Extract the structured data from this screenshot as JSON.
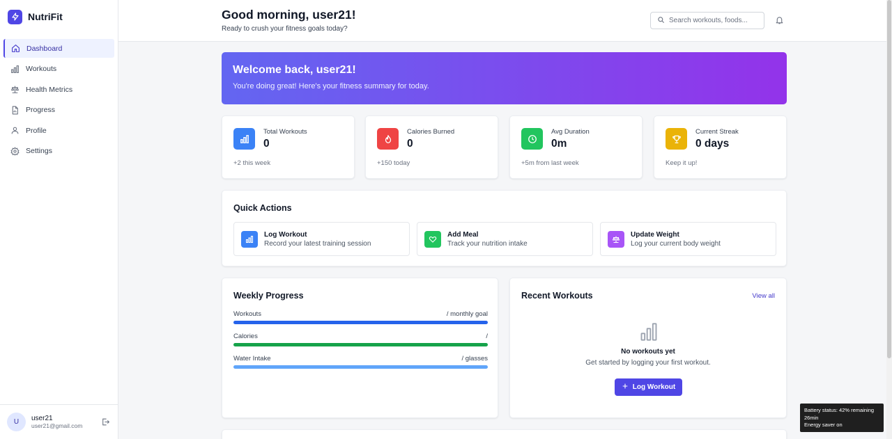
{
  "app": {
    "name": "NutriFit",
    "brand_color": "#4f46e5"
  },
  "sidebar": {
    "items": [
      {
        "label": "Dashboard",
        "icon": "home-icon",
        "active": true
      },
      {
        "label": "Workouts",
        "icon": "bar-chart-icon"
      },
      {
        "label": "Health Metrics",
        "icon": "scale-icon"
      },
      {
        "label": "Progress",
        "icon": "document-icon"
      },
      {
        "label": "Profile",
        "icon": "user-icon"
      },
      {
        "label": "Settings",
        "icon": "gear-icon"
      }
    ],
    "user": {
      "initial": "U",
      "name": "user21",
      "email": "user21@gmail.com"
    }
  },
  "header": {
    "greeting": "Good morning, user21!",
    "subtitle": "Ready to crush your fitness goals today?",
    "search_placeholder": "Search workouts, foods..."
  },
  "banner": {
    "title": "Welcome back, user21!",
    "subtitle": "You're doing great! Here's your fitness summary for today."
  },
  "stats": [
    {
      "label": "Total Workouts",
      "value": "0",
      "foot": "+2 this week",
      "color": "#3b82f6",
      "icon": "bar-chart-icon"
    },
    {
      "label": "Calories Burned",
      "value": "0",
      "foot": "+150 today",
      "color": "#ef4444",
      "icon": "flame-icon"
    },
    {
      "label": "Avg Duration",
      "value": "0m",
      "foot": "+5m from last week",
      "color": "#22c55e",
      "icon": "clock-icon"
    },
    {
      "label": "Current Streak",
      "value": "0 days",
      "foot": "Keep it up!",
      "color": "#eab308",
      "icon": "trophy-icon"
    }
  ],
  "quick_actions": {
    "title": "Quick Actions",
    "items": [
      {
        "title": "Log Workout",
        "subtitle": "Record your latest training session",
        "color": "#3b82f6",
        "icon": "bar-chart-icon"
      },
      {
        "title": "Add Meal",
        "subtitle": "Track your nutrition intake",
        "color": "#22c55e",
        "icon": "heart-icon"
      },
      {
        "title": "Update Weight",
        "subtitle": "Log your current body weight",
        "color": "#a855f7",
        "icon": "scale-icon"
      }
    ]
  },
  "weekly_progress": {
    "title": "Weekly Progress",
    "rows": [
      {
        "label": "Workouts",
        "value": "/ monthly goal",
        "color": "#2563eb",
        "fill": 1.0
      },
      {
        "label": "Calories",
        "value": "/",
        "color": "#16a34a",
        "fill": 1.0
      },
      {
        "label": "Water Intake",
        "value": "/ glasses",
        "color": "#60a5fa",
        "fill": 1.0
      }
    ]
  },
  "recent_workouts": {
    "title": "Recent Workouts",
    "view_all": "View all",
    "empty_title": "No workouts yet",
    "empty_subtitle": "Get started by logging your first workout.",
    "button": "Log Workout"
  },
  "toast": {
    "line1": "Battery status: 42% remaining",
    "line2": "26min",
    "line3": "Energy saver on"
  }
}
